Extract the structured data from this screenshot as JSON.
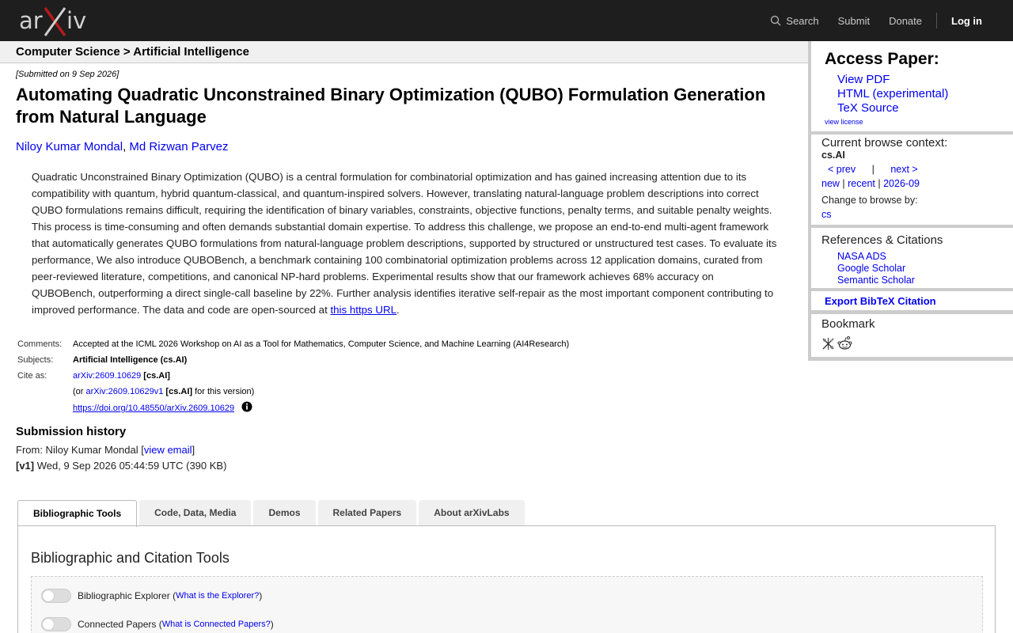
{
  "header": {
    "logo_text": "arXiv",
    "search_label": "Search",
    "submit_label": "Submit",
    "donate_label": "Donate",
    "login_label": "Log in"
  },
  "breadcrumb": "Computer Science > Artificial Intelligence",
  "paper": {
    "submitted": "[Submitted on 9 Sep 2026]",
    "title": "Automating Quadratic Unconstrained Binary Optimization (QUBO) Formulation Generation from Natural Language",
    "authors": [
      "Niloy Kumar Mondal",
      "Md Rizwan Parvez"
    ],
    "author_sep": ", ",
    "abstract": "Quadratic Unconstrained Binary Optimization (QUBO) is a central formulation for combinatorial optimization and has gained increasing attention due to its compatibility with quantum, hybrid quantum-classical, and quantum-inspired solvers. However, translating natural-language problem descriptions into correct QUBO formulations remains difficult, requiring the identification of binary variables, constraints, objective functions, penalty terms, and suitable penalty weights. This process is time-consuming and often demands substantial domain expertise. To address this challenge, we propose an end-to-end multi-agent framework that automatically generates QUBO formulations from natural-language problem descriptions, supported by structured or unstructured test cases. To evaluate its performance, We also introduce QUBOBench, a benchmark containing 100 combinatorial optimization problems across 12 application domains, curated from peer-reviewed literature, competitions, and canonical NP-hard problems. Experimental results show that our framework achieves 68% accuracy on QUBOBench, outperforming a direct single-call baseline by 22%. Further analysis identifies iterative self-repair as the most important component contributing to improved performance. The data and code are open-sourced at ",
    "abstract_link": "this https URL",
    "abstract_end": "."
  },
  "meta": {
    "comments_label": "Comments:",
    "comments": "Accepted at the ICML 2026 Workshop on AI as a Tool for Mathematics, Computer Science, and Machine Learning (AI4Research)",
    "subjects_label": "Subjects:",
    "subjects": "Artificial Intelligence (cs.AI)",
    "cite_label": "Cite as:",
    "cite_id": "arXiv:2609.10629",
    "cite_cat": "[cs.AI]",
    "cite_v1_prefix": "(or ",
    "cite_v1_id": "arXiv:2609.10629v1",
    "cite_v1_cat": "[cs.AI]",
    "cite_v1_suffix": " for this version)",
    "doi": "https://doi.org/10.48550/arXiv.2609.10629"
  },
  "history": {
    "title": "Submission history",
    "from_prefix": "From: Niloy Kumar Mondal [",
    "view_email": "view email",
    "from_suffix": "]",
    "v1_label": "[v1]",
    "v1_text": " Wed, 9 Sep 2026 05:44:59 UTC (390 KB)"
  },
  "tabs": [
    {
      "label": "Bibliographic Tools",
      "active": true
    },
    {
      "label": "Code, Data, Media",
      "active": false
    },
    {
      "label": "Demos",
      "active": false
    },
    {
      "label": "Related Papers",
      "active": false
    },
    {
      "label": "About arXivLabs",
      "active": false
    }
  ],
  "panel": {
    "title": "Bibliographic and Citation Tools",
    "toggles": [
      {
        "label": "Bibliographic Explorer",
        "link": "What is the Explorer?"
      },
      {
        "label": "Connected Papers",
        "link": "What is Connected Papers?"
      }
    ]
  },
  "sidebar": {
    "access_title": "Access Paper:",
    "access_links": [
      "View PDF",
      "HTML (experimental)",
      "TeX Source"
    ],
    "view_license": "view license",
    "browse_title": "Current browse context:",
    "browse_cat": "cs.AI",
    "prev": "< prev",
    "browse_sep": "|",
    "next": "next >",
    "new": "new",
    "recent": "recent",
    "date": "2026-09",
    "change_label": "Change to browse by:",
    "change_cat": "cs",
    "refs_title": "References & Citations",
    "refs_links": [
      "NASA ADS",
      "Google Scholar",
      "Semantic Scholar"
    ],
    "export_label": "Export BibTeX Citation",
    "bookmark_title": "Bookmark"
  },
  "colors": {
    "header_bg": "#1e1e1e",
    "logo_x": "#b31b1b",
    "link": "#0000ee"
  }
}
